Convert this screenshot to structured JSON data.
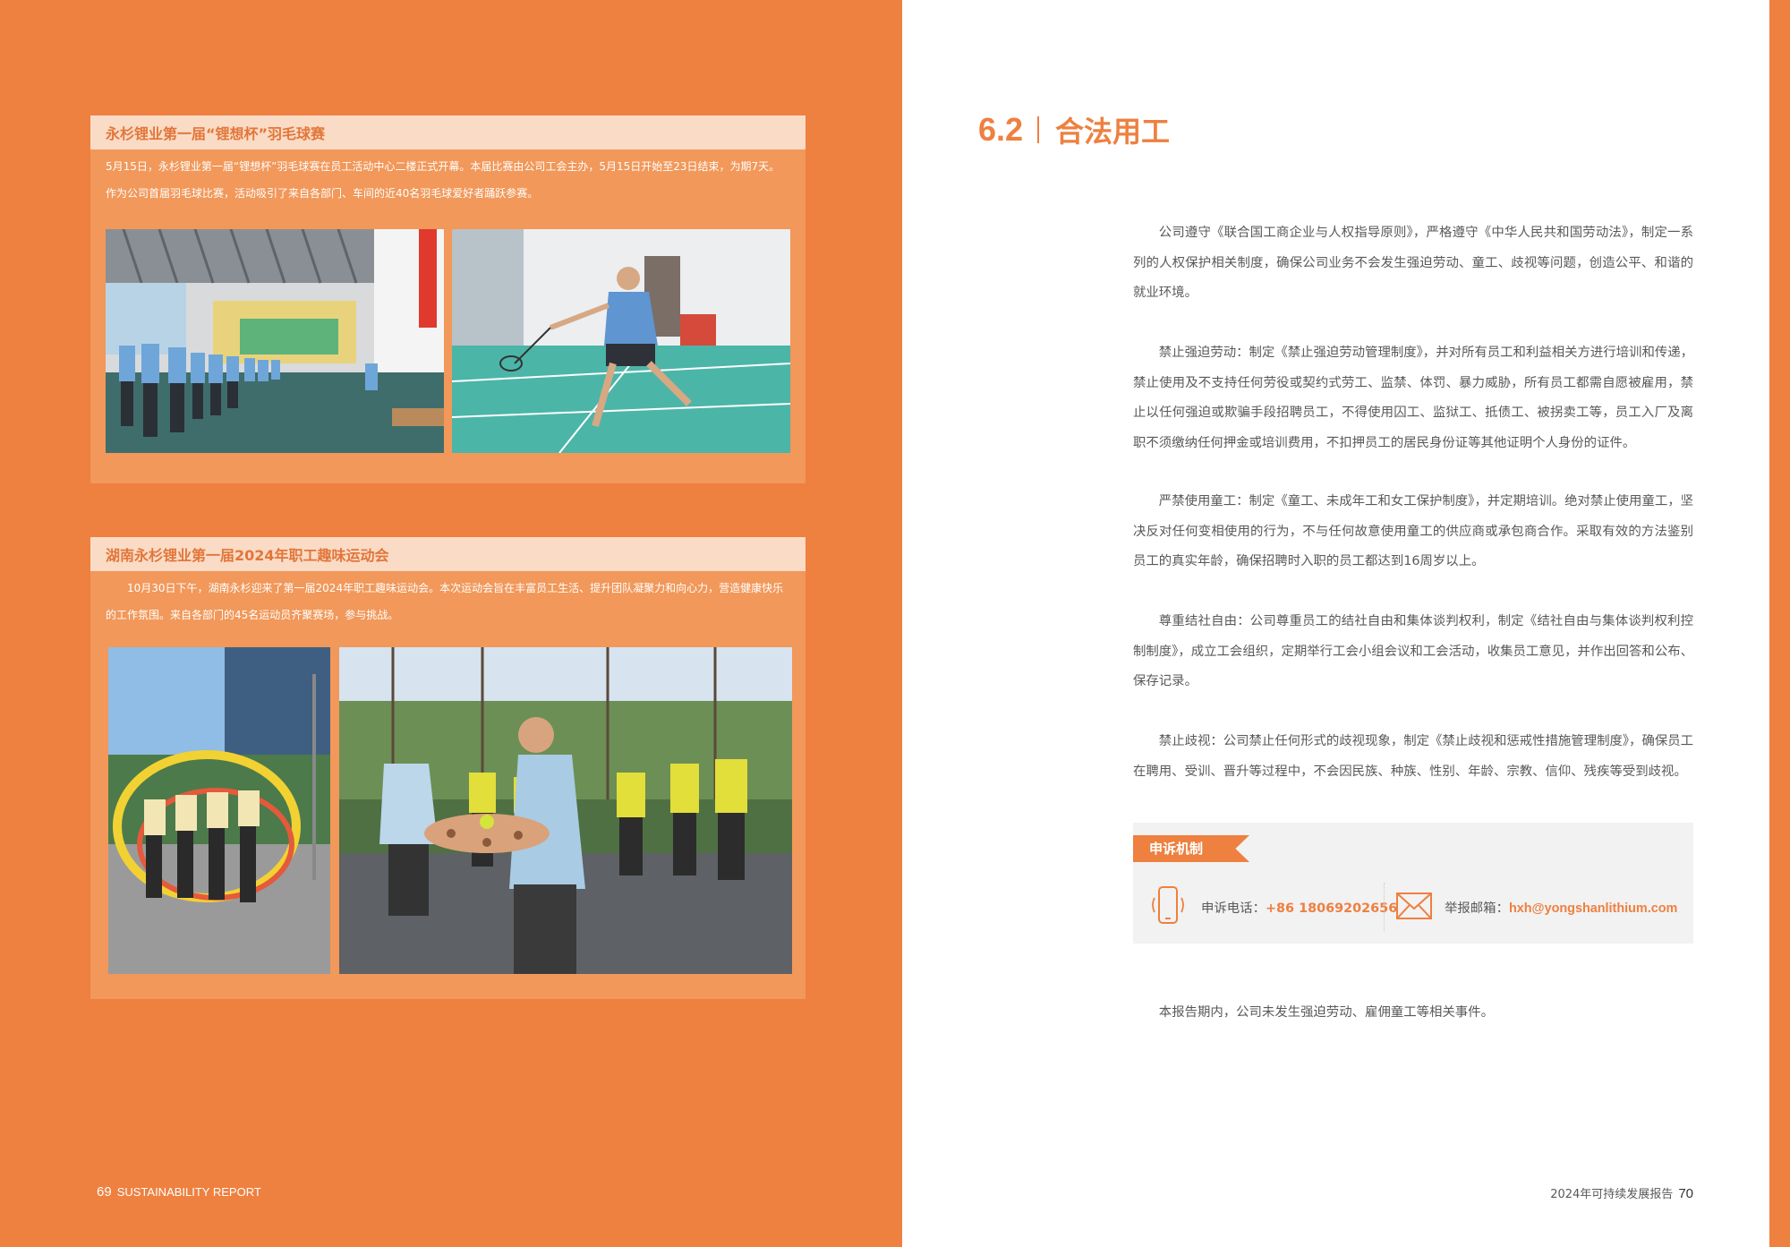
{
  "left": {
    "card1": {
      "title": "永杉锂业第一届“锂想杯”羽毛球赛",
      "text": "5月15日，永杉锂业第一届“锂想杯”羽毛球赛在员工活动中心二楼正式开幕。本届比赛由公司工会主办，5月15日开始至23日结束，为期7天。作为公司首届羽毛球比赛，活动吸引了来自各部门、车间的近40名羽毛球爱好者踊跃参赛。"
    },
    "card2": {
      "title": "湖南永杉锂业第一届2024年职工趣味运动会",
      "text": "10月30日下午，湖南永杉迎来了第一届2024年职工趣味运动会。本次运动会旨在丰富员工生活、提升团队凝聚力和向心力，营造健康快乐的工作氛围。来自各部门的45名运动员齐聚赛场，参与挑战。"
    },
    "footer": {
      "page": "69",
      "label": "SUSTAINABILITY REPORT"
    }
  },
  "right": {
    "section_number": "6.2",
    "section_title": "合法用工",
    "paragraphs": [
      "公司遵守《联合国工商企业与人权指导原则》，严格遵守《中华人民共和国劳动法》，制定一系列的人权保护相关制度，确保公司业务不会发生强迫劳动、童工、歧视等问题，创造公平、和谐的就业环境。",
      "禁止强迫劳动：制定《禁止强迫劳动管理制度》，并对所有员工和利益相关方进行培训和传递，禁止使用及不支持任何劳役或契约式劳工、监禁、体罚、暴力威胁，所有员工都需自愿被雇用，禁止以任何强迫或欺骗手段招聘员工，不得使用囚工、监狱工、抵债工、被拐卖工等，员工入厂及离职不须缴纳任何押金或培训费用，不扣押员工的居民身份证等其他证明个人身份的证件。",
      "严禁使用童工：制定《童工、未成年工和女工保护制度》，并定期培训。绝对禁止使用童工，坚决反对任何变相使用的行为，不与任何故意使用童工的供应商或承包商合作。采取有效的方法鉴别员工的真实年龄，确保招聘时入职的员工都达到16周岁以上。",
      "尊重结社自由：公司尊重员工的结社自由和集体谈判权利，制定《结社自由与集体谈判权利控制制度》，成立工会组织，定期举行工会小组会议和工会活动，收集员工意见，并作出回答和公布、保存记录。",
      "禁止歧视：公司禁止任何形式的歧视现象，制定《禁止歧视和惩戒性措施管理制度》，确保员工在聘用、受训、晋升等过程中，不会因民族、种族、性别、年龄、宗教、信仰、残疾等受到歧视。"
    ],
    "appeal": {
      "tag": "申诉机制",
      "phone_label": "申诉电话：",
      "phone": "+86 18069202656",
      "mail_label": "举报邮箱：",
      "mail": "hxh@yongshanlithium.com"
    },
    "closing": "本报告期内，公司未发生强迫劳动、雇佣童工等相关事件。",
    "footer": {
      "label": "2024年可持续发展报告",
      "page": "70"
    }
  }
}
